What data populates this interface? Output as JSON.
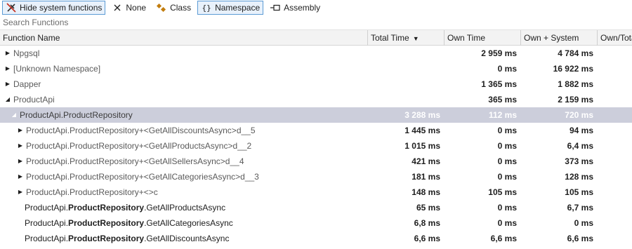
{
  "toolbar": {
    "hide_system": "Hide system functions",
    "none": "None",
    "class": "Class",
    "namespace": "Namespace",
    "assembly": "Assembly"
  },
  "search": {
    "placeholder": "Search Functions"
  },
  "columns": {
    "name": "Function Name",
    "total": "Total Time",
    "own": "Own Time",
    "own_system": "Own + System",
    "own_total": "Own/Tota"
  },
  "rows": [
    {
      "name": "Npgsql",
      "total": "",
      "own": "2 959 ms",
      "own_system": "4 784 ms"
    },
    {
      "name": "[Unknown Namespace]",
      "total": "",
      "own": "0 ms",
      "own_system": "16 922 ms"
    },
    {
      "name": "Dapper",
      "total": "",
      "own": "1 365 ms",
      "own_system": "1 882 ms"
    },
    {
      "name": "ProductApi",
      "total": "",
      "own": "365 ms",
      "own_system": "2 159 ms"
    },
    {
      "name": "ProductApi.ProductRepository",
      "total": "3 288 ms",
      "own": "112 ms",
      "own_system": "720 ms"
    },
    {
      "name": "ProductApi.ProductRepository+<GetAllDiscountsAsync>d__5",
      "total": "1 445 ms",
      "own": "0 ms",
      "own_system": "94 ms"
    },
    {
      "name": "ProductApi.ProductRepository+<GetAllProductsAsync>d__2",
      "total": "1 015 ms",
      "own": "0 ms",
      "own_system": "6,4 ms"
    },
    {
      "name": "ProductApi.ProductRepository+<GetAllSellersAsync>d__4",
      "total": "421 ms",
      "own": "0 ms",
      "own_system": "373 ms"
    },
    {
      "name": "ProductApi.ProductRepository+<GetAllCategoriesAsync>d__3",
      "total": "181 ms",
      "own": "0 ms",
      "own_system": "128 ms"
    },
    {
      "name": "ProductApi.ProductRepository+<>c",
      "total": "148 ms",
      "own": "105 ms",
      "own_system": "105 ms"
    },
    {
      "name_prefix": "ProductApi.",
      "name_bold": "ProductRepository",
      "name_suffix": ".GetAllProductsAsync",
      "total": "65 ms",
      "own": "0 ms",
      "own_system": "6,7 ms"
    },
    {
      "name_prefix": "ProductApi.",
      "name_bold": "ProductRepository",
      "name_suffix": ".GetAllCategoriesAsync",
      "total": "6,8 ms",
      "own": "0 ms",
      "own_system": "0 ms"
    },
    {
      "name_prefix": "ProductApi.",
      "name_bold": "ProductRepository",
      "name_suffix": ".GetAllDiscountsAsync",
      "total": "6,6 ms",
      "own": "6,6 ms",
      "own_system": "6,6 ms"
    }
  ]
}
